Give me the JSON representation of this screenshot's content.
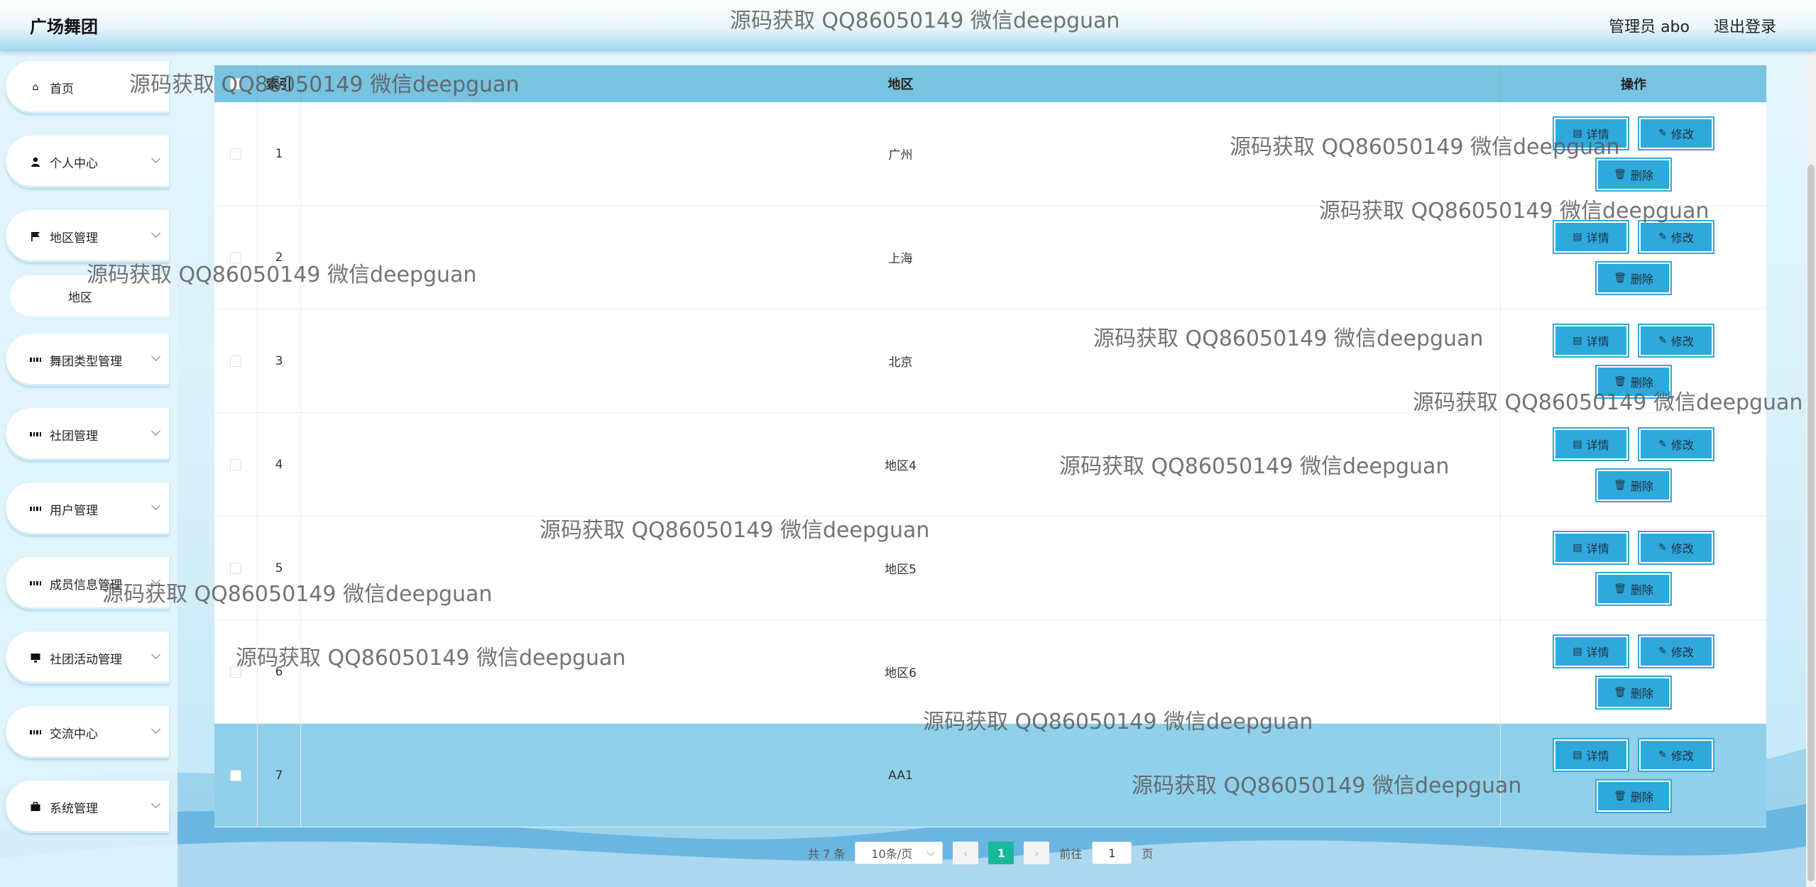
{
  "header": {
    "title": "广场舞团",
    "user": "管理员 abo",
    "logout": "退出登录"
  },
  "sidebar": {
    "items": [
      {
        "label": "首页",
        "icon": "home-icon"
      },
      {
        "label": "个人中心",
        "icon": "user-icon"
      },
      {
        "label": "地区管理",
        "icon": "flag-icon",
        "sub": "地区"
      },
      {
        "label": "舞团类型管理",
        "icon": "grid-icon"
      },
      {
        "label": "社团管理",
        "icon": "grid-icon"
      },
      {
        "label": "用户管理",
        "icon": "grid-icon"
      },
      {
        "label": "成员信息管理",
        "icon": "grid-icon"
      },
      {
        "label": "社团活动管理",
        "icon": "monitor-icon"
      },
      {
        "label": "交流中心",
        "icon": "grid-icon"
      },
      {
        "label": "系统管理",
        "icon": "briefcase-icon"
      }
    ]
  },
  "table": {
    "headers": {
      "index": "索引",
      "region": "地区",
      "ops": "操作"
    },
    "rows": [
      {
        "index": "1",
        "region": "广州"
      },
      {
        "index": "2",
        "region": "上海"
      },
      {
        "index": "3",
        "region": "北京"
      },
      {
        "index": "4",
        "region": "地区4"
      },
      {
        "index": "5",
        "region": "地区5"
      },
      {
        "index": "6",
        "region": "地区6"
      },
      {
        "index": "7",
        "region": "AA1"
      }
    ],
    "buttons": {
      "detail": "详情",
      "edit": "修改",
      "delete": "删除"
    }
  },
  "pagination": {
    "total": "共 7 条",
    "page_size": "10条/页",
    "current": "1",
    "goto_label": "前往",
    "goto_value": "1",
    "page_unit": "页"
  },
  "watermark": "源码获取 QQ86050149 微信deepguan",
  "colors": {
    "header_bar": "#78c3e0",
    "button": "#2fa8dc",
    "active_page": "#18b89a",
    "highlight_row": "#90d0ea"
  }
}
